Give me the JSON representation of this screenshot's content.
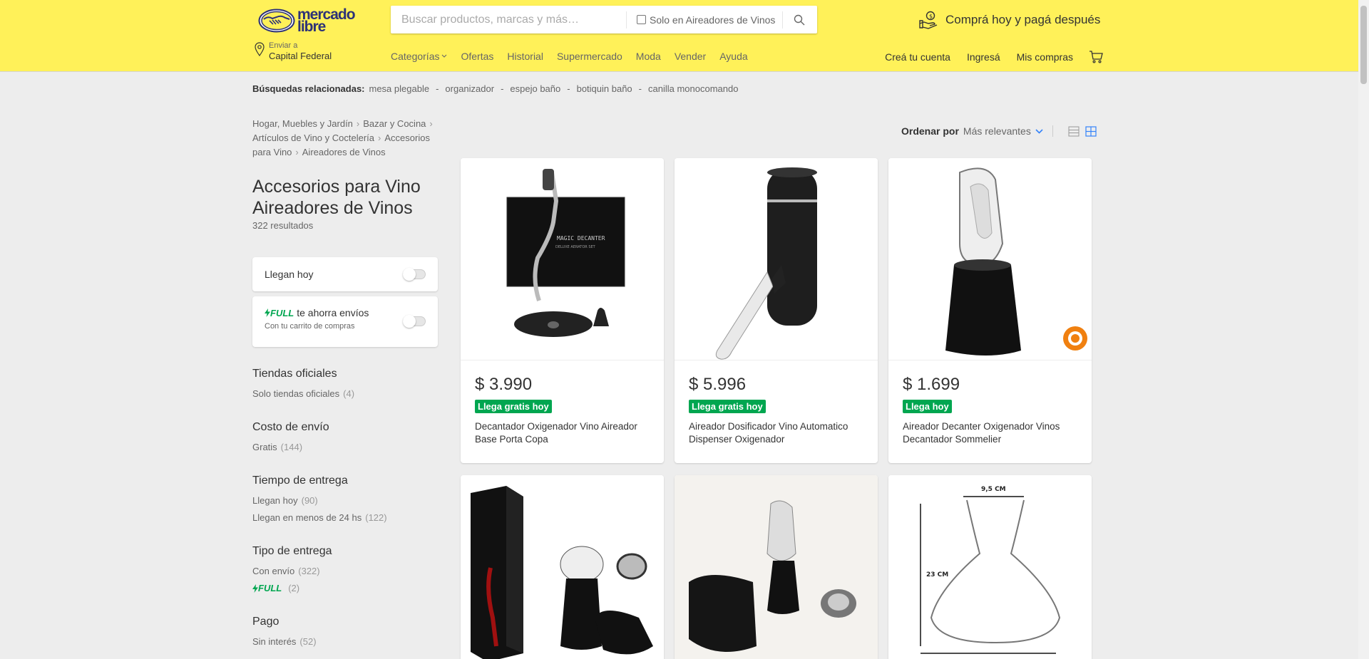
{
  "header": {
    "logo_line1": "mercado",
    "logo_line2": "libre",
    "search_placeholder": "Buscar productos, marcas y más…",
    "search_filter_label": "Solo en Aireadores de Vinos",
    "promo_text": "Comprá hoy y pagá después",
    "location_label": "Enviar a",
    "location_value": "Capital Federal",
    "nav": [
      "Categorías",
      "Ofertas",
      "Historial",
      "Supermercado",
      "Moda",
      "Vender",
      "Ayuda"
    ],
    "user_nav": [
      "Creá tu cuenta",
      "Ingresá",
      "Mis compras"
    ],
    "brand_color": "#fff159"
  },
  "related": {
    "label": "Búsquedas relacionadas:",
    "items": [
      "mesa plegable",
      "organizador",
      "espejo baño",
      "botiquin baño",
      "canilla monocomando"
    ]
  },
  "breadcrumb": [
    "Hogar, Muebles y Jardín",
    "Bazar y Cocina",
    "Artículos de Vino y Coctelería",
    "Accesorios para Vino",
    "Aireadores de Vinos"
  ],
  "page": {
    "title_line1": "Accesorios para Vino",
    "title_line2": "Aireadores de Vinos",
    "results": "322 resultados"
  },
  "toggles": {
    "llegan_hoy": "Llegan hoy",
    "full_logo": "FULL",
    "full_text": "te ahorra envíos",
    "full_sub": "Con tu carrito de compras"
  },
  "filters": [
    {
      "title": "Tiendas oficiales",
      "items": [
        {
          "label": "Solo tiendas oficiales",
          "count": "(4)"
        }
      ]
    },
    {
      "title": "Costo de envío",
      "items": [
        {
          "label": "Gratis",
          "count": "(144)"
        }
      ]
    },
    {
      "title": "Tiempo de entrega",
      "items": [
        {
          "label": "Llegan hoy",
          "count": "(90)"
        },
        {
          "label": "Llegan en menos de 24 hs",
          "count": "(122)"
        }
      ]
    },
    {
      "title": "Tipo de entrega",
      "items": [
        {
          "label": "Con envío",
          "count": "(322)"
        },
        {
          "label": "FULL",
          "count": "(2)"
        }
      ]
    },
    {
      "title": "Pago",
      "items": [
        {
          "label": "Sin interés",
          "count": "(52)"
        }
      ]
    }
  ],
  "sort": {
    "label": "Ordenar por",
    "value": "Más relevantes"
  },
  "products": [
    {
      "price": "$ 3.990",
      "badge": "Llega gratis hoy",
      "title": "Decantador Oxigenador Vino Aireador Base Porta Copa"
    },
    {
      "price": "$ 5.996",
      "badge": "Llega gratis hoy",
      "title": "Aireador Dosificador Vino Automatico Dispenser Oxigenador"
    },
    {
      "price": "$ 1.699",
      "badge": "Llega hoy",
      "title": "Aireador Decanter Oxigenador Vinos Decantador Sommelier"
    },
    {
      "price": "",
      "badge": "",
      "title": ""
    },
    {
      "price": "",
      "badge": "",
      "title": ""
    },
    {
      "price": "",
      "badge": "",
      "title": ""
    }
  ],
  "product_image_text": {
    "box_label": "MAGIC DECANTER",
    "box_sub": "DELUXE AERATOR SET",
    "dim_width": "9,5 CM",
    "dim_height": "23 CM"
  },
  "colors": {
    "accent": "#3483fa",
    "green": "#00a650",
    "text": "#333333"
  }
}
